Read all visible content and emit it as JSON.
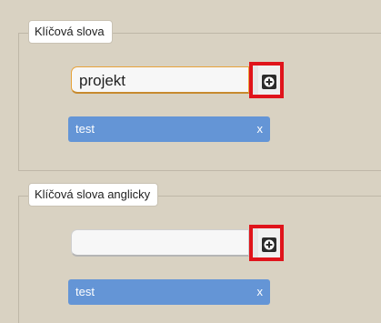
{
  "keywords": {
    "legend": "Klíčová slova",
    "input_value": "projekt",
    "tag": {
      "label": "test",
      "remove": "x"
    }
  },
  "keywords_en": {
    "legend": "Klíčová slova anglicky",
    "input_value": "",
    "tag": {
      "label": "test",
      "remove": "x"
    }
  },
  "colors": {
    "background": "#d9d2c2",
    "tag": "#6495d6",
    "highlight": "#e0141b",
    "focus": "#e8a33a"
  },
  "icons": {
    "add": "plus-circle-icon"
  }
}
